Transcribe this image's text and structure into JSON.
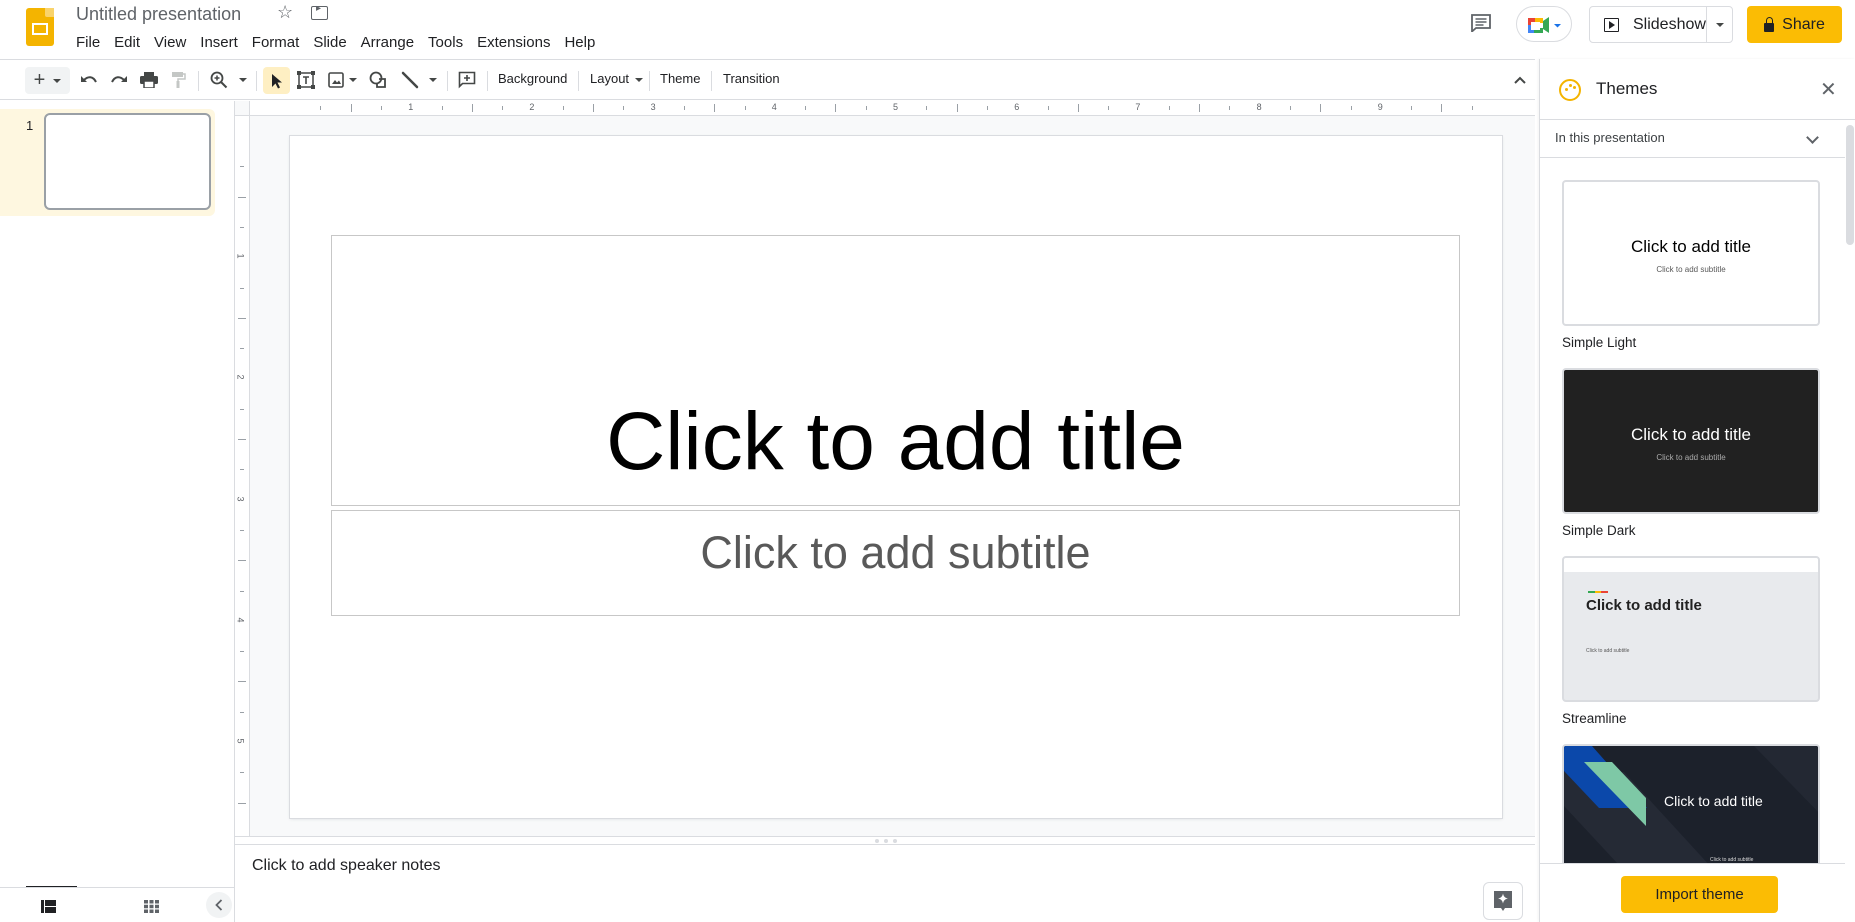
{
  "app": {
    "doc_title": "Untitled presentation",
    "menu": [
      "File",
      "Edit",
      "View",
      "Insert",
      "Format",
      "Slide",
      "Arrange",
      "Tools",
      "Extensions",
      "Help"
    ],
    "slideshow_label": "Slideshow",
    "share_label": "Share",
    "colors": {
      "accent": "#fbbc04",
      "logo": "#f4b400",
      "selected_row": "#fef7e0"
    }
  },
  "toolbar": {
    "background_label": "Background",
    "layout_label": "Layout",
    "theme_label": "Theme",
    "transition_label": "Transition"
  },
  "filmstrip": {
    "slides": [
      {
        "number": "1"
      }
    ]
  },
  "ruler": {
    "horizontal_labels": [
      "1",
      "2",
      "3",
      "4",
      "5",
      "6",
      "7",
      "8",
      "9"
    ],
    "vertical_labels": [
      "1",
      "2",
      "3",
      "4",
      "5"
    ]
  },
  "slide": {
    "title_placeholder": "Click to add title",
    "subtitle_placeholder": "Click to add subtitle"
  },
  "notes": {
    "placeholder": "Click to add speaker notes"
  },
  "themes_panel": {
    "title": "Themes",
    "filter_label": "In this presentation",
    "themes": [
      {
        "name": "Simple Light",
        "preview_title": "Click to add title",
        "preview_subtitle": "Click to add subtitle"
      },
      {
        "name": "Simple Dark",
        "preview_title": "Click to add title",
        "preview_subtitle": "Click to add subtitle"
      },
      {
        "name": "Streamline",
        "preview_title": "Click to add title",
        "preview_subtitle": "Click to add subtitle"
      },
      {
        "name": "",
        "preview_title": "Click to add title",
        "preview_subtitle": "Click to add subtitle"
      }
    ],
    "import_label": "Import theme"
  }
}
